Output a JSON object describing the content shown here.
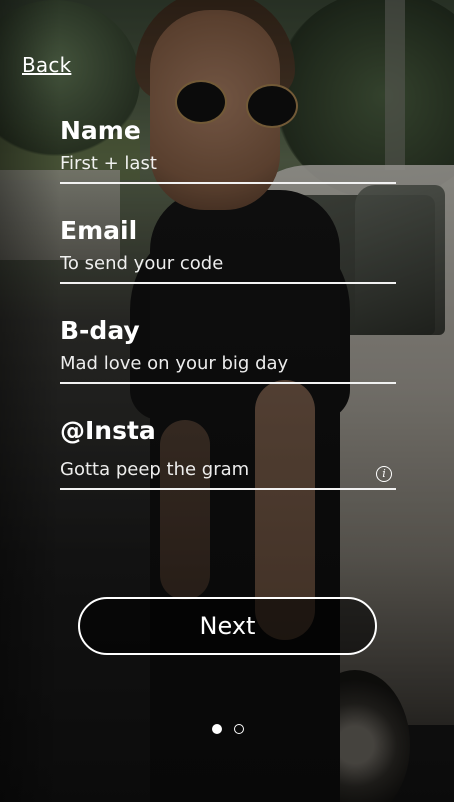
{
  "nav": {
    "back_label": "Back"
  },
  "form": {
    "fields": [
      {
        "label": "Name",
        "placeholder": "First + last",
        "value": ""
      },
      {
        "label": "Email",
        "placeholder": "To send your code",
        "value": ""
      },
      {
        "label": "B-day",
        "placeholder": "Mad love on your big day",
        "value": ""
      },
      {
        "label": "@Insta",
        "placeholder": "Gotta peep the gram",
        "value": "",
        "icon": "info-icon"
      }
    ]
  },
  "actions": {
    "next_label": "Next"
  },
  "pager": {
    "total": 2,
    "current": 1
  }
}
